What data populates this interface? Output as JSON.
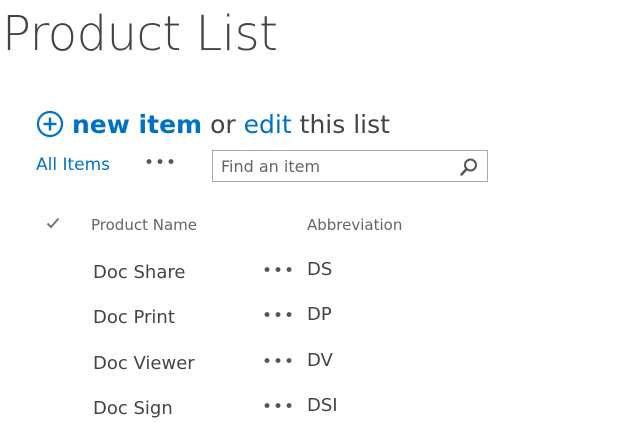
{
  "page": {
    "title": "Product List"
  },
  "toolbar": {
    "new_item_label": "new item",
    "or_text": "or",
    "edit_label": "edit",
    "this_list_text": "this list"
  },
  "views": {
    "all_items_label": "All Items",
    "more_label": "•••"
  },
  "search": {
    "placeholder": "Find an item",
    "value": ""
  },
  "table": {
    "columns": [
      {
        "label": "Product Name"
      },
      {
        "label": "Abbreviation"
      }
    ],
    "rows": [
      {
        "name": "Doc Share",
        "menu": "•••",
        "abbreviation": "DS"
      },
      {
        "name": "Doc Print",
        "menu": "•••",
        "abbreviation": "DP"
      },
      {
        "name": "Doc Viewer",
        "menu": "•••",
        "abbreviation": "DV"
      },
      {
        "name": "Doc Sign",
        "menu": "•••",
        "abbreviation": "DSI"
      }
    ]
  },
  "icons": {
    "add": "plus-circle-icon",
    "search": "search-icon",
    "select_all": "checkmark-icon"
  },
  "colors": {
    "link": "#0072c6",
    "text": "#444444",
    "muted": "#666666",
    "border": "#ababab"
  }
}
